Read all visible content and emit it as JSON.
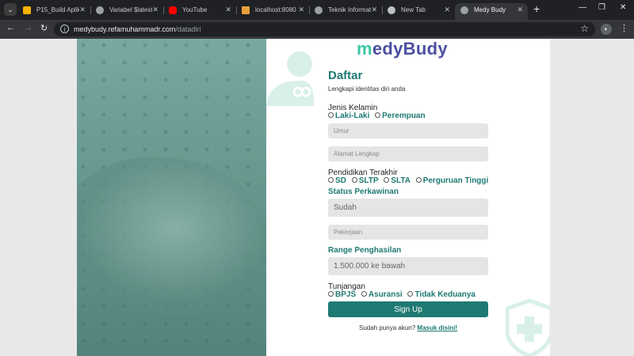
{
  "browser": {
    "tabs": [
      {
        "label": "P15_Build Aplika",
        "favicon_color": "#f6b400",
        "active": false
      },
      {
        "label": "Variabel $latest",
        "favicon_color": "#9aa0a6",
        "active": false
      },
      {
        "label": "YouTube",
        "favicon_color": "#ff0000",
        "active": false
      },
      {
        "label": "localhost:8080 /",
        "favicon_color": "#e8a03a",
        "active": false
      },
      {
        "label": "Teknik Informati",
        "favicon_color": "#9aa0a6",
        "active": false
      },
      {
        "label": "New Tab",
        "favicon_color": "#bdc1c6",
        "active": false
      },
      {
        "label": "Medy Budy",
        "favicon_color": "#9aa0a6",
        "active": true
      }
    ],
    "url_host": "medybudy.refamuhammadr.com",
    "url_path": "/datadiri",
    "icons": {
      "back": "←",
      "forward": "→",
      "reload": "↻",
      "star": "☆",
      "close": "✕",
      "new_tab": "+",
      "minimize": "—",
      "restore": "❐",
      "more": "⋮",
      "tab_menu": "⌄",
      "site_info": "i",
      "extension": "◐"
    }
  },
  "page": {
    "colors": {
      "accent": "#1e7a72",
      "logo_blue": "#4b4fa0",
      "logo_green": "#3ec9a4",
      "field_bg": "#e5e5e5"
    },
    "logo_m": "m",
    "logo_rest": "edyBudy",
    "title": "Daftar",
    "subtitle": "Lengkapi identitas diri anda",
    "gender": {
      "label": "Jenis Kelamin",
      "options": [
        "Laki-Laki",
        "Perempuan"
      ]
    },
    "age_placeholder": "Umur",
    "address_placeholder": "Alamat Lengkap",
    "education": {
      "label": "Pendidikan Terakhir",
      "options": [
        "SD",
        "SLTP",
        "SLTA",
        "Perguruan Tinggi"
      ]
    },
    "marital": {
      "label": "Status Perkawinan",
      "value": "Sudah"
    },
    "job_placeholder": "Pekerjaan",
    "income": {
      "label": "Range Penghasilan",
      "value": "1.500.000 ke bawah"
    },
    "benefits": {
      "label": "Tunjangan",
      "options": [
        "BPJS",
        "Asuransi",
        "Tidak Keduanya"
      ]
    },
    "signup_label": "Sign Up",
    "login_prompt": "Sudah punya akun?",
    "login_link": "Masuk disini!"
  }
}
